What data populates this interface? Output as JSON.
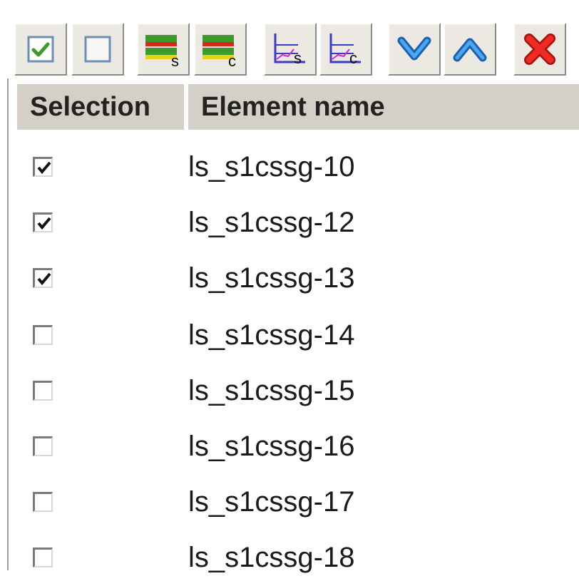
{
  "toolbar": {
    "buttons": [
      {
        "icon": "select-all-checkbox-icon",
        "tooltip": ""
      },
      {
        "icon": "deselect-all-checkbox-icon",
        "tooltip": ""
      },
      {
        "icon": "bar-s-icon",
        "label": "s"
      },
      {
        "icon": "bar-c-icon",
        "label": "c"
      },
      {
        "icon": "chart-s-icon",
        "label": "s"
      },
      {
        "icon": "chart-c-icon",
        "label": "c"
      },
      {
        "icon": "chevron-down-icon"
      },
      {
        "icon": "chevron-up-icon"
      },
      {
        "icon": "close-icon"
      }
    ]
  },
  "table": {
    "headers": {
      "selection": "Selection",
      "name": "Element name"
    },
    "rows": [
      {
        "checked": true,
        "name": "ls_s1cssg-10"
      },
      {
        "checked": true,
        "name": "ls_s1cssg-12"
      },
      {
        "checked": true,
        "name": "ls_s1cssg-13"
      },
      {
        "checked": false,
        "name": "ls_s1cssg-14"
      },
      {
        "checked": false,
        "name": "ls_s1cssg-15"
      },
      {
        "checked": false,
        "name": "ls_s1cssg-16"
      },
      {
        "checked": false,
        "name": "ls_s1cssg-17"
      },
      {
        "checked": false,
        "name": "ls_s1cssg-18"
      }
    ]
  },
  "colors": {
    "header_bg": "#d4d0c8",
    "toolbar_bg": "#ece9e2",
    "check_green": "#3a9a2a",
    "chevron_blue": "#2a7bd4",
    "close_red": "#e0201c"
  }
}
